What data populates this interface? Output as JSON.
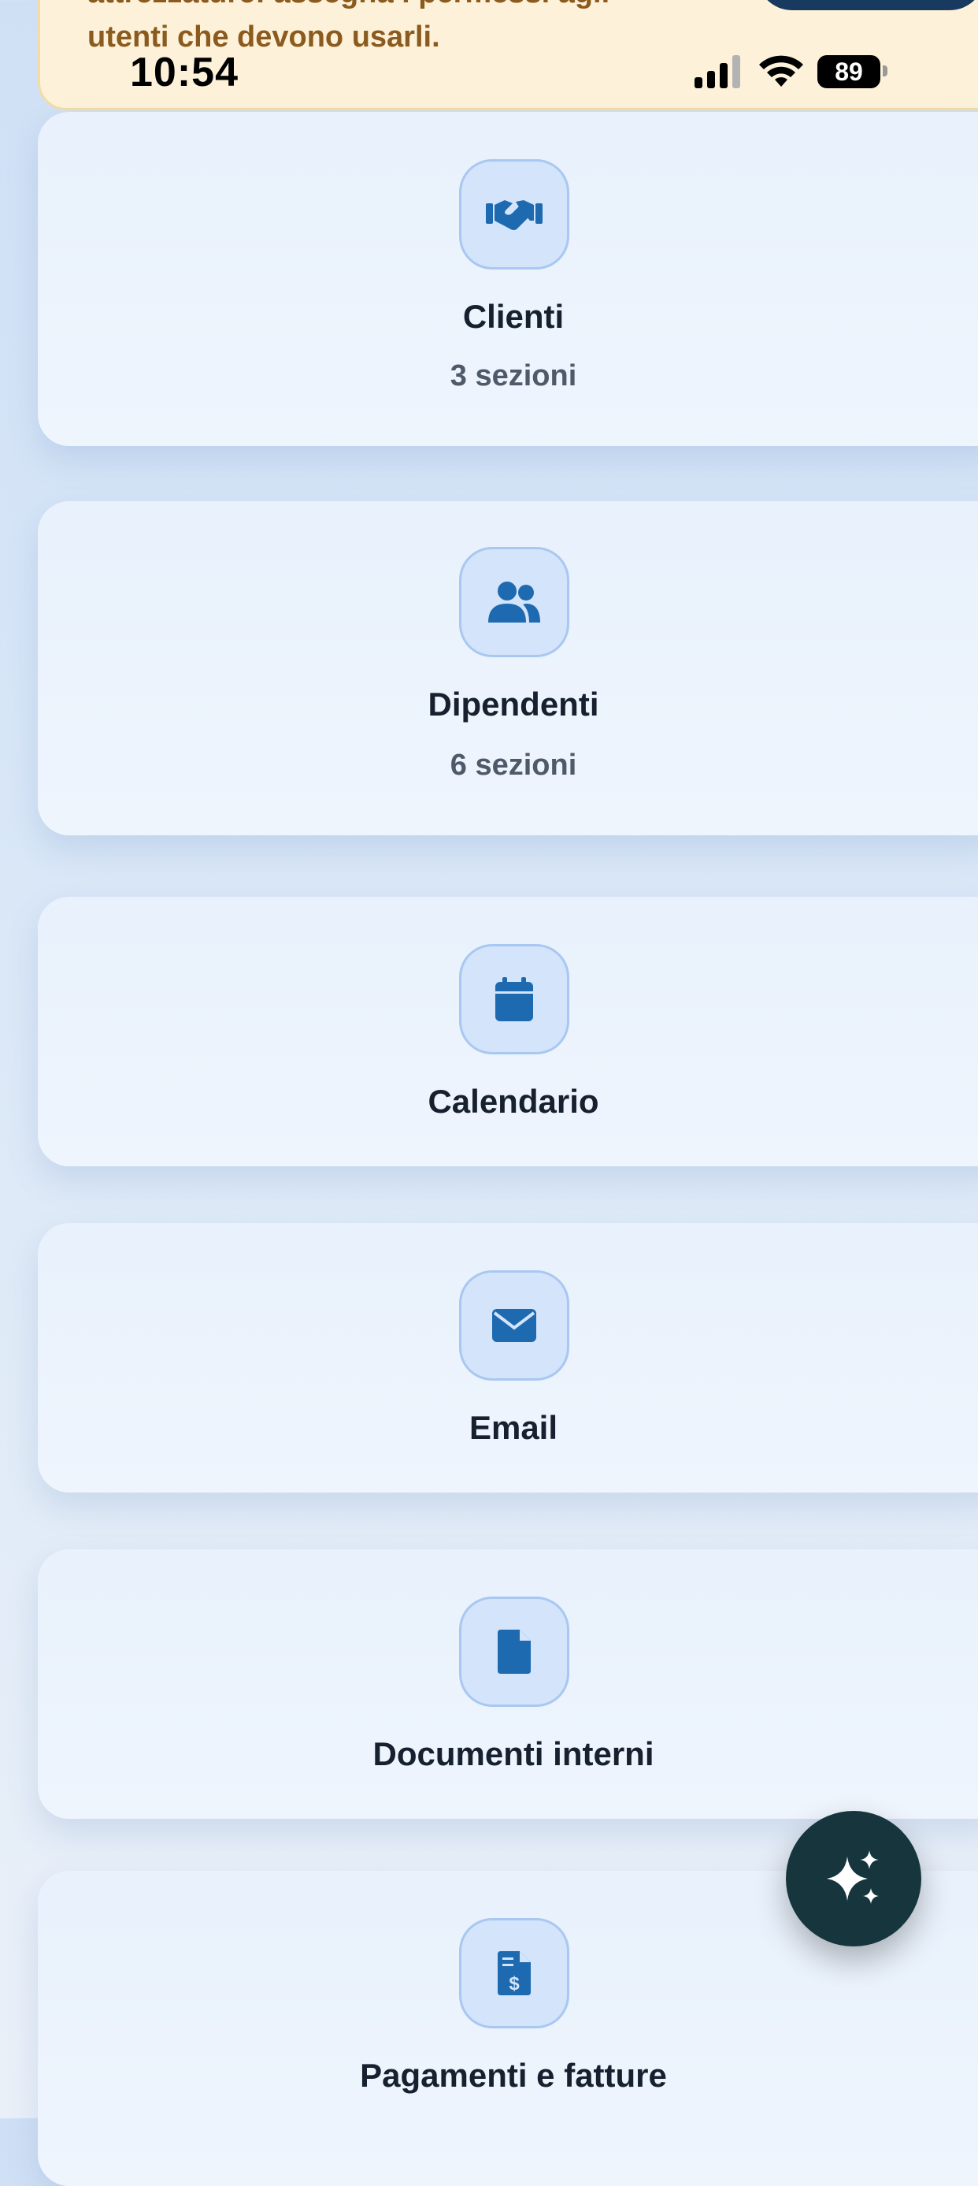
{
  "banner": {
    "text_line1": "attrezzature: assegna i permessi agli",
    "text_line2": "utenti che devono usarli."
  },
  "status_bar": {
    "time": "10:54",
    "battery": "89"
  },
  "cards": [
    {
      "title": "Clienti",
      "subtitle": "3 sezioni",
      "icon": "handshake-icon"
    },
    {
      "title": "Dipendenti",
      "subtitle": "6 sezioni",
      "icon": "users-icon"
    },
    {
      "title": "Calendario",
      "icon": "calendar-icon"
    },
    {
      "title": "Email",
      "icon": "envelope-icon"
    },
    {
      "title": "Documenti interni",
      "icon": "document-icon"
    },
    {
      "title": "Pagamenti e fatture",
      "icon": "invoice-icon"
    }
  ],
  "fab": {
    "icon": "sparkles-icon"
  },
  "colors": {
    "accent": "#1e6ab0",
    "fab": "#16353d",
    "banner_bg": "#fdf2d9",
    "banner_text": "#8b5a1e"
  }
}
